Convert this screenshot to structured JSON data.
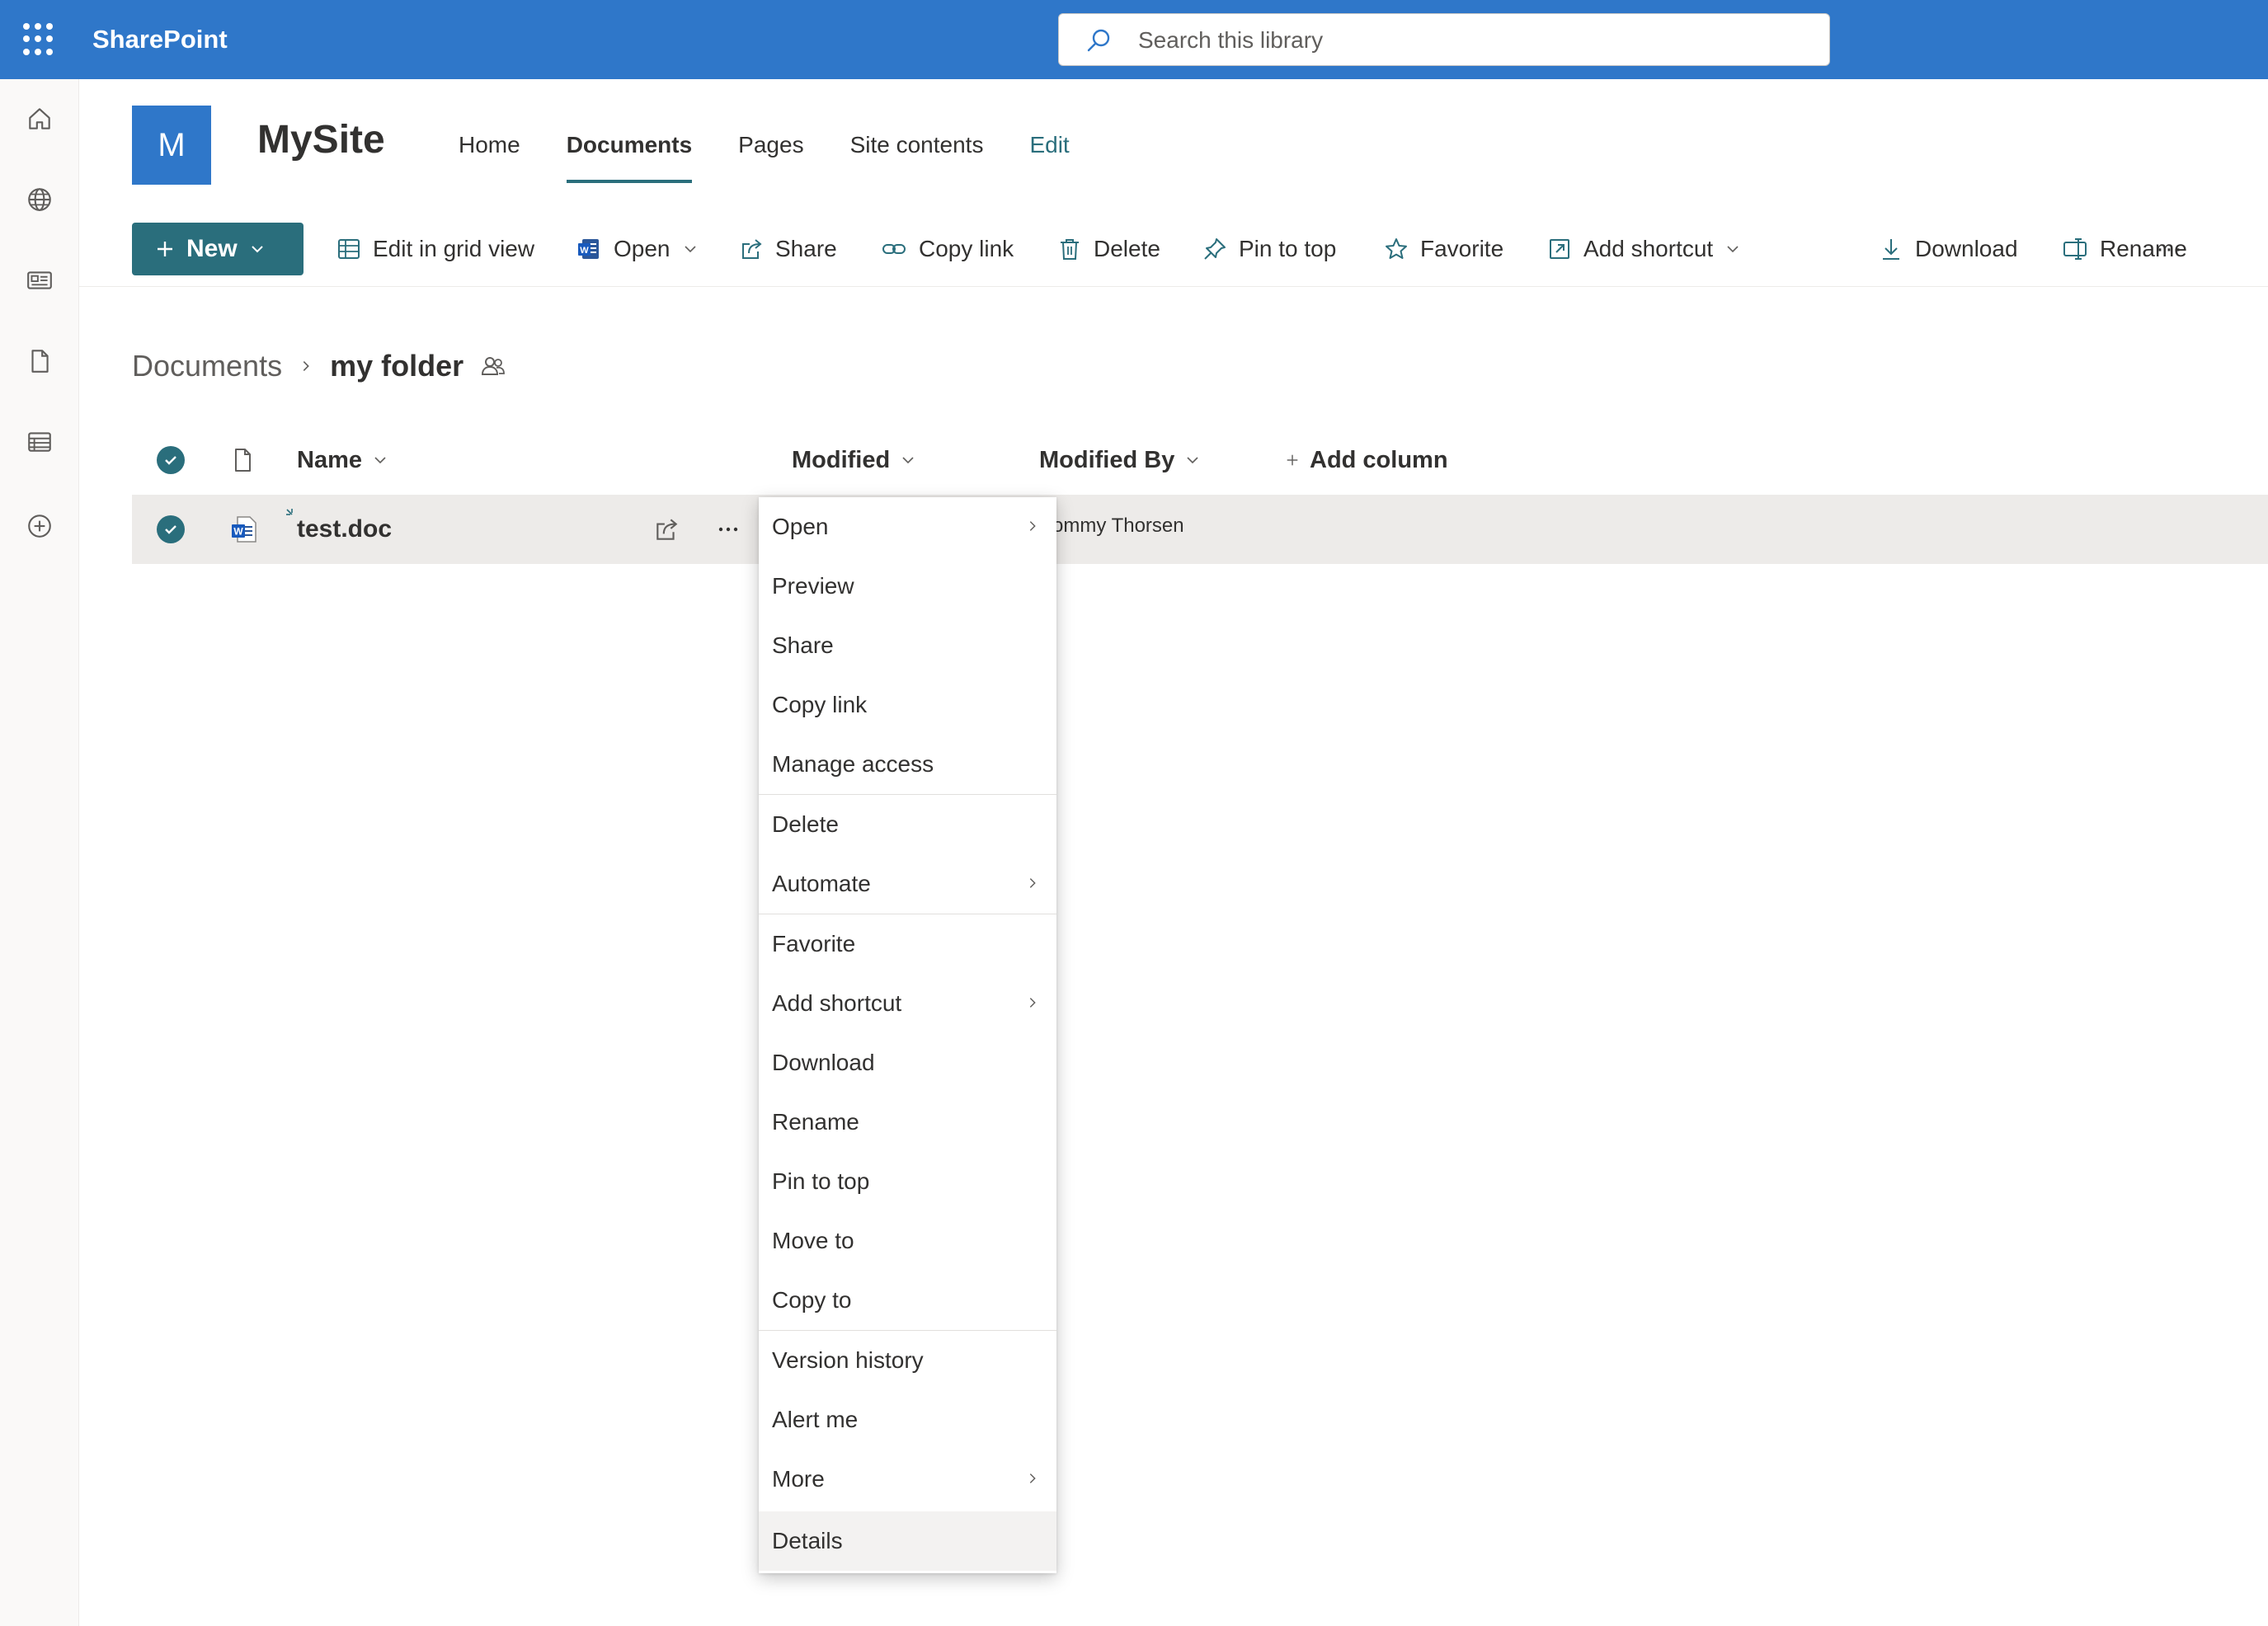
{
  "suitebar": {
    "app_name": "SharePoint",
    "search_placeholder": "Search this library"
  },
  "site": {
    "logo_letter": "M",
    "title": "MySite",
    "nav": [
      "Home",
      "Documents",
      "Pages",
      "Site contents",
      "Edit"
    ],
    "active_nav": "Documents"
  },
  "commands": {
    "new": "New",
    "edit_grid": "Edit in grid view",
    "open": "Open",
    "share": "Share",
    "copy_link": "Copy link",
    "delete": "Delete",
    "pin_to_top": "Pin to top",
    "favorite": "Favorite",
    "add_shortcut": "Add shortcut",
    "download": "Download",
    "rename": "Rename",
    "more": "···"
  },
  "breadcrumb": {
    "root": "Documents",
    "current": "my folder"
  },
  "list": {
    "headers": {
      "name": "Name",
      "modified": "Modified",
      "modified_by": "Modified By",
      "add_column": "Add column"
    },
    "rows": [
      {
        "name": "test.doc",
        "modified_by": "ommy Thorsen",
        "selected": true
      }
    ]
  },
  "context_menu": {
    "items": [
      "Open",
      "Preview",
      "Share",
      "Copy link",
      "Manage access",
      "Delete",
      "Automate",
      "Favorite",
      "Add shortcut",
      "Download",
      "Rename",
      "Pin to top",
      "Move to",
      "Copy to",
      "Version history",
      "Alert me",
      "More",
      "Details"
    ],
    "submenu_items": [
      "Open",
      "Automate",
      "Add shortcut",
      "More"
    ],
    "highlighted": "Details"
  },
  "colors": {
    "suite_blue": "#2f77c9",
    "accent_teal": "#2a6e7c",
    "selected_row": "#edebe9"
  }
}
